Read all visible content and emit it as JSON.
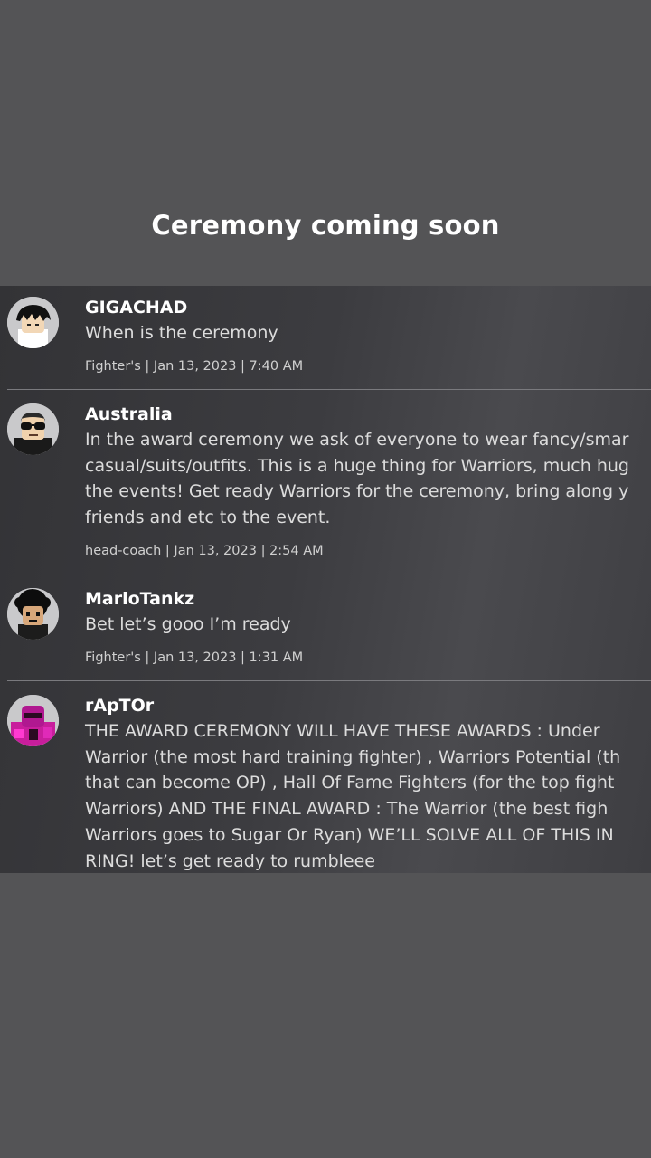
{
  "caption": "Ceremony coming soon",
  "comments": [
    {
      "username": "GIGACHAD",
      "avatar_icon": "roblox-avatar-black-hair-icon",
      "lines": [
        "When is the ceremony"
      ],
      "meta": "Fighter's | Jan 13, 2023 | 7:40 AM"
    },
    {
      "username": "Australia",
      "avatar_icon": "roblox-avatar-sunglasses-icon",
      "lines": [
        "In the award ceremony we ask of everyone to wear fancy/smar",
        "casual/suits/outfits. This is a huge thing for Warriors, much hug",
        "the events! Get ready Warriors for the ceremony, bring along y",
        "friends and etc to the event."
      ],
      "meta": "head-coach | Jan 13, 2023 | 2:54 AM"
    },
    {
      "username": "MarloTankz",
      "avatar_icon": "roblox-avatar-afro-icon",
      "lines": [
        "Bet let’s gooo I’m ready"
      ],
      "meta": "Fighter's | Jan 13, 2023 | 1:31 AM"
    },
    {
      "username": "rApTOr",
      "avatar_icon": "roblox-avatar-pink-icon",
      "lines": [
        "THE AWARD CEREMONY WILL HAVE THESE AWARDS : Under",
        "Warrior (the most hard training fighter) , Warriors Potential (th",
        "that can become OP) , Hall Of Fame Fighters (for the top fight",
        "Warriors) AND THE FINAL AWARD : The Warrior (the best figh",
        "Warriors goes to Sugar Or Ryan) WE’LL SOLVE ALL OF THIS IN",
        "RING! let’s get ready to rumbleee"
      ],
      "meta": ""
    }
  ],
  "colors": {
    "background": "#545456",
    "panel": "#3c3c40",
    "text_primary": "#ffffff",
    "text_body": "#dcdcdc",
    "divider": "#7a7a7e"
  }
}
